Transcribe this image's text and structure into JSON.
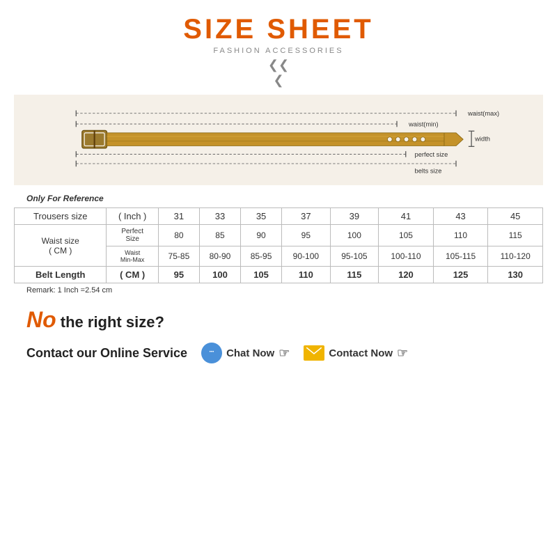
{
  "header": {
    "title": "SIZE SHEET",
    "subtitle": "FASHION ACCESSORIES",
    "chevron": "❯❯"
  },
  "belt_diagram": {
    "labels": {
      "waist_max": "waist(max)",
      "waist_min": "waist(min)",
      "perfect_size": "perfect size",
      "belts_size": "belts size",
      "width": "width"
    }
  },
  "table": {
    "reference_note": "Only For Reference",
    "remark": "Remark: 1 Inch =2.54 cm",
    "headers": {
      "trousers_label": "Trousers size",
      "inch_label": "( Inch )",
      "waist_label": "Waist size",
      "waist_cm": "( CM )",
      "belt_length": "Belt Length",
      "belt_cm": "( CM )",
      "perfect_size": "Perfect Size",
      "waist_min_max": "Waist Min-Max"
    },
    "sizes": [
      "31",
      "33",
      "35",
      "37",
      "39",
      "41",
      "43",
      "45"
    ],
    "perfect_sizes": [
      "80",
      "85",
      "90",
      "95",
      "100",
      "105",
      "110",
      "115"
    ],
    "waist_min_max": [
      "75-85",
      "80-90",
      "85-95",
      "90-100",
      "95-105",
      "100-110",
      "105-115",
      "110-120"
    ],
    "belt_lengths": [
      "95",
      "100",
      "105",
      "110",
      "115",
      "120",
      "125",
      "130"
    ]
  },
  "bottom": {
    "no_text": "No",
    "right_size_text": " the right size?",
    "contact_label": "Contact our Online Service",
    "chat_btn": "Chat Now",
    "contact_btn": "Contact Now"
  }
}
